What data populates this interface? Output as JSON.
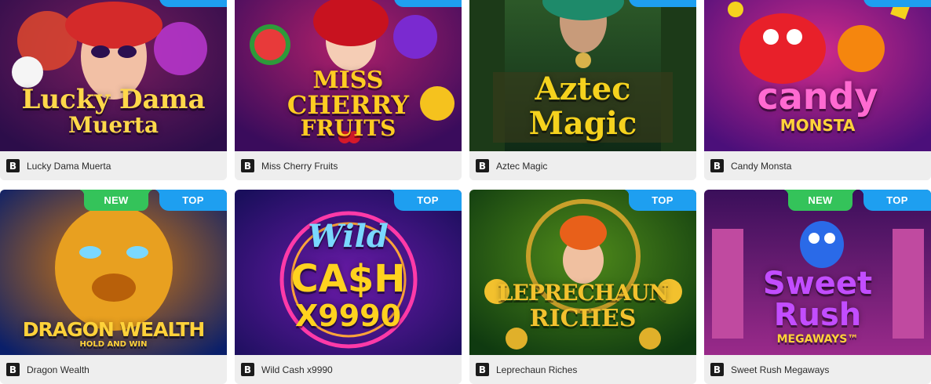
{
  "badges": {
    "top": "TOP",
    "new": "NEW"
  },
  "provider_mark": "B",
  "games": [
    {
      "id": "lucky-dama-muerta",
      "name": "Lucky Dama Muerta",
      "art_title": [
        "Lucky Dama",
        "Muerta"
      ],
      "badges": [
        "top"
      ],
      "colors": {
        "bg1": "#2c0d4a",
        "bg2": "#7a1d5e",
        "title": "#ffd84a"
      }
    },
    {
      "id": "miss-cherry-fruits",
      "name": "Miss Cherry Fruits",
      "art_title": [
        "MISS",
        "CHERRY",
        "FRUITS"
      ],
      "badges": [
        "top"
      ],
      "colors": {
        "bg1": "#3a0c5c",
        "bg2": "#b0206a",
        "title": "#ffcc22"
      }
    },
    {
      "id": "aztec-magic",
      "name": "Aztec Magic",
      "art_title": [
        "Aztec",
        "Magic"
      ],
      "badges": [
        "top"
      ],
      "colors": {
        "bg1": "#0f2a16",
        "bg2": "#2f5d2a",
        "title": "#f5d21e"
      }
    },
    {
      "id": "candy-monsta",
      "name": "Candy Monsta",
      "art_title": [
        "candy",
        "MONSTA"
      ],
      "badges": [
        "top"
      ],
      "colors": {
        "bg1": "#4b0f7a",
        "bg2": "#d02a8a",
        "title": "#ff6ad1"
      }
    },
    {
      "id": "dragon-wealth",
      "name": "Dragon Wealth",
      "art_title": [
        "DRAGON WEALTH",
        "HOLD AND WIN"
      ],
      "badges": [
        "new",
        "top"
      ],
      "colors": {
        "bg1": "#0a1f6a",
        "bg2": "#d87a0c",
        "title": "#ffd23a"
      }
    },
    {
      "id": "wild-cash-x9990",
      "name": "Wild Cash x9990",
      "art_title": [
        "Wild",
        "CA$H",
        "X9990"
      ],
      "badges": [
        "top"
      ],
      "colors": {
        "bg1": "#1a0f5c",
        "bg2": "#6a1aa8",
        "title": "#ffd21f"
      }
    },
    {
      "id": "leprechaun-riches",
      "name": "Leprechaun Riches",
      "art_title": [
        "LEPRECHAUN",
        "RICHES"
      ],
      "badges": [
        "top"
      ],
      "colors": {
        "bg1": "#0f3a10",
        "bg2": "#4f8a1a",
        "title": "#f2c12e"
      }
    },
    {
      "id": "sweet-rush-megaways",
      "name": "Sweet Rush Megaways",
      "art_title": [
        "Sweet",
        "Rush",
        "MEGAWAYS™"
      ],
      "badges": [
        "new",
        "top"
      ],
      "colors": {
        "bg1": "#3a0f5a",
        "bg2": "#9a2a8a",
        "title": "#c24dff"
      }
    }
  ]
}
